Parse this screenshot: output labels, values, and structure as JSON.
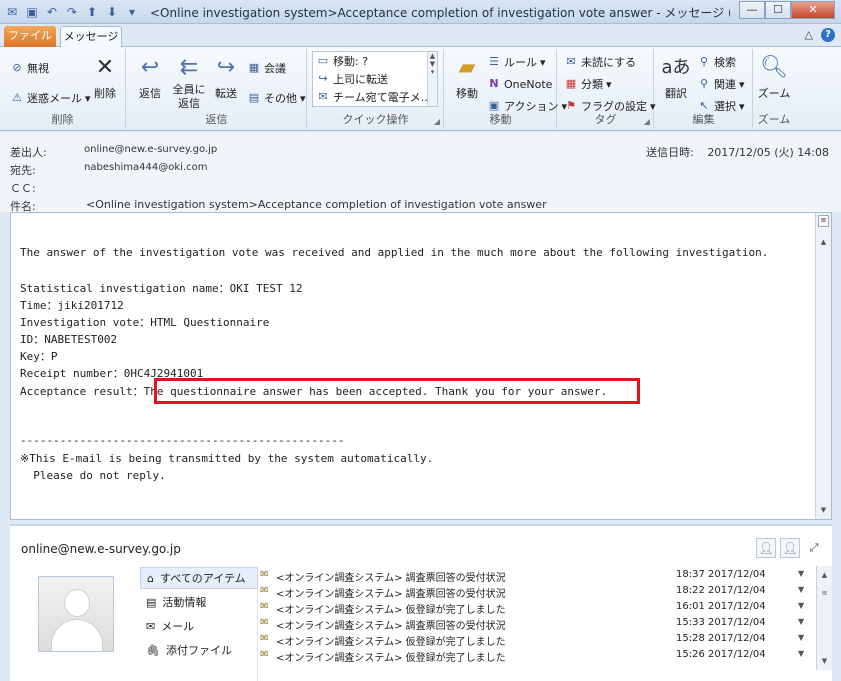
{
  "window": {
    "title": "<Online investigation system>Acceptance completion of investigation vote answer - メッセージ (テキスト…",
    "buttons": {
      "minimize": "—",
      "maximize": "☐",
      "close": "✕"
    }
  },
  "tabs": {
    "file": "ファイル",
    "message": "メッセージ"
  },
  "ribbon": {
    "delete_group": {
      "ignore": "無視",
      "junk": "迷惑メール",
      "delete": "削除",
      "label": "削除"
    },
    "reply_group": {
      "reply": "返信",
      "reply_all_line1": "全員に",
      "reply_all_line2": "返信",
      "forward": "転送",
      "meeting": "会議",
      "other": "その他",
      "label": "返信"
    },
    "quick_group": {
      "move_to": "移動: ?",
      "to_manager": "上司に転送",
      "team_email": "チーム宛て電子メ…",
      "label": "クイック操作"
    },
    "move_group": {
      "move": "移動",
      "rules": "ルール",
      "onenote": "OneNote",
      "actions": "アクション",
      "label": "移動"
    },
    "tags_group": {
      "unread": "未読にする",
      "categorize": "分類",
      "followup": "フラグの設定",
      "label": "タグ"
    },
    "edit_group": {
      "translate": "翻訳",
      "find": "検索",
      "related": "関連",
      "select": "選択",
      "label": "編集"
    },
    "zoom_group": {
      "zoom": "ズーム",
      "label": "ズーム"
    }
  },
  "header": {
    "from_label": "差出人:",
    "from": "online@new.e-survey.go.jp",
    "to_label": "宛先:",
    "to": "nabeshima444@oki.com",
    "cc_label": "ＣＣ:",
    "subject_label": "件名:",
    "subject": "<Online investigation system>Acceptance completion of investigation vote answer",
    "sent_label": "送信日時:",
    "sent": "2017/12/05 (火) 14:08"
  },
  "body": {
    "lines": [
      "The answer of the investigation vote was received and applied in the much more about the following investigation.",
      "Statistical investigation name：OKI TEST 12",
      "Time：jiki201712",
      "Investigation vote：HTML Questionnaire",
      "ID：NABETEST002",
      "Key：P",
      "Receipt number：0HC4J2941001",
      "Acceptance result：The questionnaire answer has been accepted. Thank you for your answer.",
      "-------------------------------------------------",
      "※This E-mail is being transmitted by the system automatically.",
      "  Please do not reply."
    ]
  },
  "people": {
    "email": "online@new.e-survey.go.jp",
    "nav": [
      "すべてのアイテム",
      "活動情報",
      "メール",
      "添付ファイル"
    ],
    "mails": [
      {
        "subject": "<オンライン調査システム> 調査票回答の受付状況",
        "date": "18:37 2017/12/04"
      },
      {
        "subject": "<オンライン調査システム> 調査票回答の受付状況",
        "date": "18:22 2017/12/04"
      },
      {
        "subject": "<オンライン調査システム> 仮登録が完了しました",
        "date": "16:01 2017/12/04"
      },
      {
        "subject": "<オンライン調査システム> 調査票回答の受付状況",
        "date": "15:33 2017/12/04"
      },
      {
        "subject": "<オンライン調査システム> 仮登録が完了しました",
        "date": "15:28 2017/12/04"
      },
      {
        "subject": "<オンライン調査システム> 仮登録が完了しました",
        "date": "15:26 2017/12/04"
      }
    ]
  }
}
